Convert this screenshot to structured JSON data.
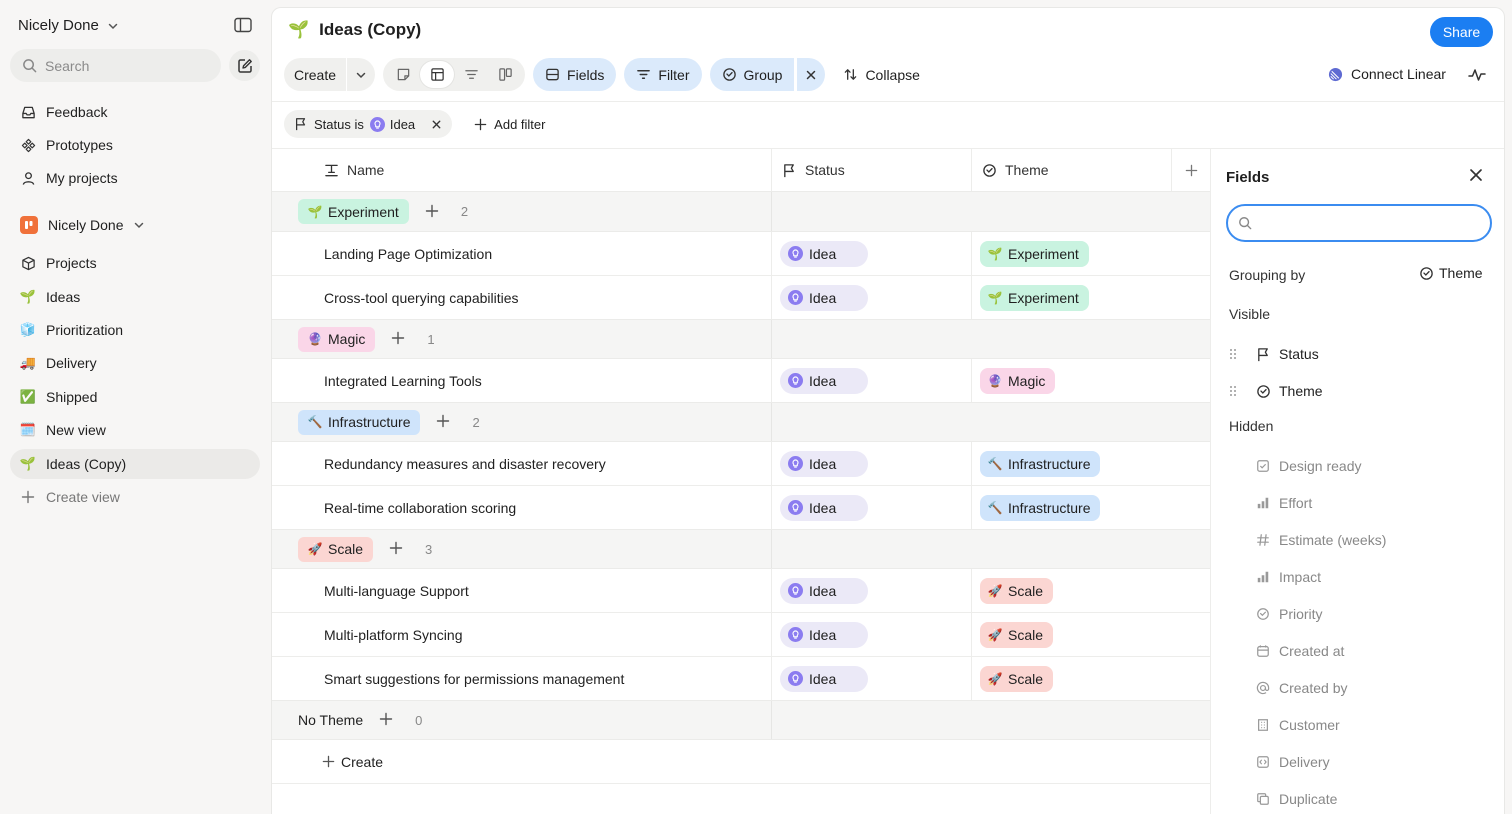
{
  "sidebar": {
    "workspace": "Nicely Done",
    "search_placeholder": "Search",
    "top_items": [
      {
        "label": "Feedback"
      },
      {
        "label": "Prototypes"
      },
      {
        "label": "My projects"
      }
    ],
    "team": "Nicely Done",
    "team_items": [
      {
        "label": "Projects",
        "icon": "cube-icon"
      },
      {
        "label": "Ideas",
        "icon": "🌱"
      },
      {
        "label": "Prioritization",
        "icon": "🧊"
      },
      {
        "label": "Delivery",
        "icon": "🚚"
      },
      {
        "label": "Shipped",
        "icon": "✅"
      },
      {
        "label": "New view",
        "icon": "🗓️"
      },
      {
        "label": "Ideas (Copy)",
        "icon": "🌱"
      }
    ],
    "create_view": "Create view"
  },
  "header": {
    "emoji": "🌱",
    "title": "Ideas (Copy)",
    "share": "Share"
  },
  "toolbar": {
    "create": "Create",
    "fields": "Fields",
    "filter": "Filter",
    "group": "Group",
    "collapse": "Collapse",
    "connect": "Connect Linear"
  },
  "filter": {
    "label": "Status is",
    "value": "Idea",
    "add": "Add filter"
  },
  "table": {
    "columns": {
      "name": "Name",
      "status": "Status",
      "theme": "Theme"
    },
    "groups": [
      {
        "name": "Experiment",
        "emoji": "🌱",
        "class": "t-experiment",
        "count": "2",
        "rows": [
          {
            "name": "Landing Page Optimization",
            "status": "Idea",
            "theme": "Experiment"
          },
          {
            "name": "Cross-tool querying capabilities",
            "status": "Idea",
            "theme": "Experiment"
          }
        ]
      },
      {
        "name": "Magic",
        "emoji": "🔮",
        "class": "t-magic",
        "count": "1",
        "rows": [
          {
            "name": "Integrated Learning Tools",
            "status": "Idea",
            "theme": "Magic"
          }
        ]
      },
      {
        "name": "Infrastructure",
        "emoji": "🔨",
        "class": "t-infra",
        "count": "2",
        "rows": [
          {
            "name": "Redundancy measures and disaster recovery",
            "status": "Idea",
            "theme": "Infrastructure"
          },
          {
            "name": "Real-time collaboration scoring",
            "status": "Idea",
            "theme": "Infrastructure"
          }
        ]
      },
      {
        "name": "Scale",
        "emoji": "🚀",
        "class": "t-scale",
        "count": "3",
        "rows": [
          {
            "name": "Multi-language Support",
            "status": "Idea",
            "theme": "Scale"
          },
          {
            "name": "Multi-platform Syncing",
            "status": "Idea",
            "theme": "Scale"
          },
          {
            "name": "Smart suggestions for permissions management",
            "status": "Idea",
            "theme": "Scale"
          }
        ]
      }
    ],
    "no_theme": {
      "name": "No Theme",
      "count": "0"
    },
    "create": "Create"
  },
  "fields_panel": {
    "title": "Fields",
    "search_value": "",
    "grouping_label": "Grouping by",
    "grouping_value": "Theme",
    "visible_label": "Visible",
    "visible": [
      {
        "label": "Status",
        "icon": "flag-icon"
      },
      {
        "label": "Theme",
        "icon": "circle-check-icon"
      }
    ],
    "hidden_label": "Hidden",
    "hidden": [
      {
        "label": "Design ready",
        "icon": "checkbox-icon"
      },
      {
        "label": "Effort",
        "icon": "bar-chart-icon"
      },
      {
        "label": "Estimate (weeks)",
        "icon": "hash-icon"
      },
      {
        "label": "Impact",
        "icon": "bar-chart-icon"
      },
      {
        "label": "Priority",
        "icon": "circle-check-icon"
      },
      {
        "label": "Created at",
        "icon": "calendar-icon"
      },
      {
        "label": "Created by",
        "icon": "at-icon"
      },
      {
        "label": "Customer",
        "icon": "building-icon"
      },
      {
        "label": "Delivery",
        "icon": "code-icon"
      },
      {
        "label": "Duplicate",
        "icon": "copy-icon"
      }
    ]
  },
  "colors": {
    "accent": "#1b7ef2",
    "toolbar_active": "#dbeafb",
    "idea": "#8b7cf0"
  }
}
